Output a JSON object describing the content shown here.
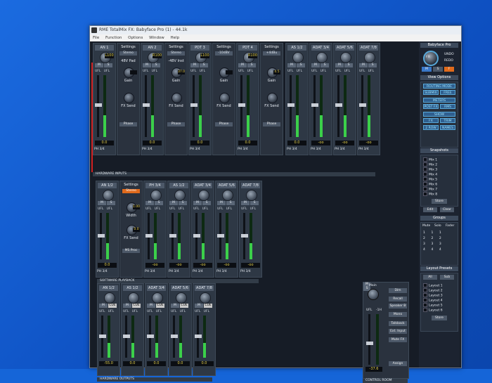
{
  "window": {
    "title": "RME TotalMix FX: Babyface Pro (1) - 44.1k",
    "menu": [
      "File",
      "Function",
      "Options",
      "Window",
      "Help"
    ]
  },
  "colors": {
    "accent": "#e06a1c",
    "meter": "#3bd04a",
    "selected": "#58a8d8",
    "record": "#d02020"
  },
  "hardware_inputs": {
    "label": "HARDWARE INPUTS",
    "channels": [
      {
        "name": "AN 1",
        "pan": "L100",
        "val": "-99.7",
        "level": "0.0",
        "ph": "PH 3/4"
      },
      {
        "name": "AN 2",
        "pan": "R100",
        "val": "-70.2",
        "level": "0.0",
        "ph": "PH 3/4"
      },
      {
        "name": "PDT 3",
        "pan": "L100",
        "val": "-87.5",
        "level": "0.0",
        "ph": "PH 3/4"
      },
      {
        "name": "PDT 4",
        "pan": "R100",
        "val": "-100",
        "level": "0.0",
        "ph": "PH 3/4"
      },
      {
        "name": "AS 1/2",
        "val": "",
        "level": "0.0",
        "ph": "PH 3/4"
      },
      {
        "name": "ADAT 3/4",
        "val": "",
        "level": "-oo",
        "ph": "PH 3/4"
      },
      {
        "name": "ADAT 5/6",
        "val": "",
        "level": "-oo",
        "ph": "PH 3/4"
      },
      {
        "name": "ADAT 7/8",
        "val": "",
        "level": "-oo",
        "ph": "PH 3/4"
      }
    ],
    "settings": [
      {
        "title": "Settings",
        "mode": "Stereo",
        "opt1": "48V",
        "opt2": "Pad",
        "gain": "Gain",
        "fx": "FX Send",
        "phase": "Phase"
      },
      {
        "title": "Settings",
        "mode": "Stereo",
        "opt1": "-48V",
        "opt2": "Inst",
        "gain": "Gain",
        "fx": "FX Send",
        "phase": "Phase",
        "num": "37.0"
      },
      {
        "title": "Settings",
        "mode": "-10dBV",
        "opt1": "",
        "opt2": "",
        "gain": "Gain",
        "fx": "FX Send",
        "phase": "Phase"
      },
      {
        "title": "Settings",
        "mode": "+4dBu",
        "opt1": "",
        "opt2": "",
        "gain": "Gain",
        "fx": "FX Send",
        "phase": "Phase",
        "num": "4.5"
      }
    ]
  },
  "software_playback": {
    "label": "SOFTWARE PLAYBACK",
    "settings": {
      "title": "Settings",
      "mode": "Stereo",
      "width": "Width",
      "width_val": "1.00",
      "fx": "FX Send",
      "ms": "MS Proc",
      "num": "0.0"
    },
    "channels": [
      {
        "name": "AN 1/2",
        "level": "0.0",
        "ph": "PH 3/4"
      },
      {
        "name": "PH 3/4",
        "level": "-oo",
        "ph": "PH 3/4"
      },
      {
        "name": "AS 1/2",
        "level": "-oo",
        "ph": "PH 3/4"
      },
      {
        "name": "ADAT 3/4",
        "level": "-oo",
        "ph": "PH 3/4"
      },
      {
        "name": "ADAT 5/6",
        "level": "-oo",
        "ph": "PH 3/4"
      },
      {
        "name": "ADAT 7/8",
        "level": "-oo",
        "ph": "PH 3/4"
      },
      {
        "name": "ADAT 7/8",
        "level": "-oo",
        "ph": "PH 3/4"
      }
    ]
  },
  "hardware_outputs": {
    "label": "HARDWARE OUTPUTS",
    "channels": [
      {
        "name": "AN 1/2",
        "level": "-55.0"
      },
      {
        "name": "AS 1/2",
        "level": "0.0"
      },
      {
        "name": "ADAT 3/4",
        "level": "0.0"
      },
      {
        "name": "ADAT 5/6",
        "level": "0.0"
      },
      {
        "name": "ADAT 7/8",
        "level": "0.0"
      }
    ]
  },
  "control_room": {
    "label": "CONTROL ROOM",
    "main": "Main",
    "dim": "Dim",
    "recall": "Recall",
    "speaker_b": "Speaker B",
    "mono": "Mono",
    "talkback": "Talkback",
    "ext_input": "Ext. Input",
    "mute_fx": "Mute FX",
    "assign": "Assign",
    "val": "-37.6",
    "ufl": "UFL",
    "minus": "-1H"
  },
  "side": {
    "device": "Babyface Pro",
    "fx": "FX",
    "undo": "UNDO",
    "redo": "REDO",
    "view_options": "View Options",
    "routing": "ROUTING MODE",
    "submix": "SUBMIX",
    "free": "FREE",
    "meters": "METERS",
    "post_fx": "POST FX",
    "rms": "RMS",
    "show": "SHOW",
    "fx_btn": "FX",
    "trim": "TRIM",
    "2row": "2 ROW",
    "names": "NAMES",
    "snapshots": "Snapshots",
    "mixes": [
      "Mix 1",
      "Mix 2",
      "Mix 3",
      "Mix 4",
      "Mix 5",
      "Mix 6",
      "Mix 7",
      "Mix 8"
    ],
    "store": "Store",
    "edit": "Edit",
    "clear": "Clear",
    "groups": "Groups",
    "mute": "Mute",
    "solo": "Solo",
    "fader": "Fader",
    "layout_presets": "Layout Presets",
    "all": "All",
    "sub": "Sub",
    "layouts": [
      "Layout 1",
      "Layout 2",
      "Layout 3",
      "Layout 4",
      "Layout 5",
      "Layout 6"
    ]
  }
}
